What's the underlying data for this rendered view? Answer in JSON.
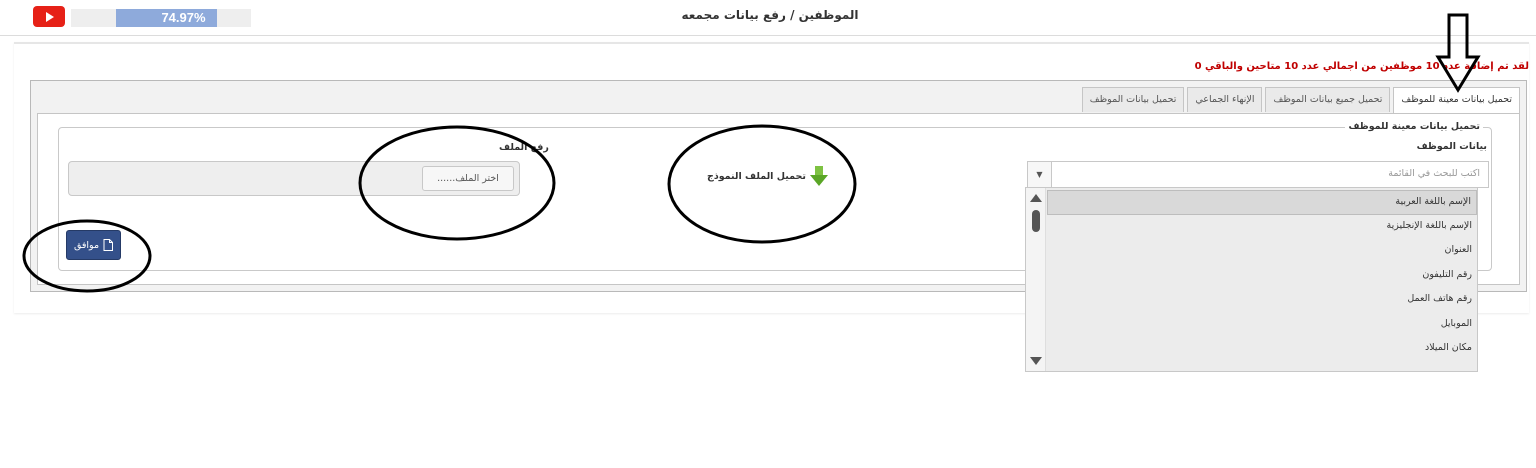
{
  "topbar": {
    "progress_text": "74.97%",
    "progress": 74.97,
    "page_title": "الموظفين / رفع بيانات مجمعه"
  },
  "notice": "لقد تم إضافة عدد 10 موظفين من اجمالي عدد 10 متاحين والباقي 0",
  "tabs": [
    {
      "label": "تحميل بيانات معينة للموظف",
      "active": true
    },
    {
      "label": "تحميل جميع بيانات الموظف",
      "active": false
    },
    {
      "label": "الإنهاء الجماعي",
      "active": false
    },
    {
      "label": "تحميل بيانات الموظف",
      "active": false
    }
  ],
  "panel": {
    "legend": "تحميل بيانات معينة للموظف",
    "employee_data_label": "بيانات الموظف",
    "select_placeholder": "اكتب للبحث في القائمة",
    "file_label": "رفع الملف",
    "file_button": "اختر الملف......",
    "download_template": "تحميل الملف النموذج",
    "ok_button": "موافق"
  },
  "dropdown_items": [
    "الإسم باللغة العربية",
    "الإسم باللغة الإنجليزية",
    "العنوان",
    "رقم التليفون",
    "رقم هاتف العمل",
    "الموبايل",
    "مكان الميلاد"
  ],
  "colors": {
    "youtube_red": "#e62117",
    "progress_fill": "#8eaadb",
    "notice_red": "#c00000",
    "ok_button": "#34508a"
  },
  "icons": {
    "youtube": "play-icon",
    "download": "green-down-arrow-icon",
    "ok": "file-icon",
    "annotation": "down-arrow-outline-icon"
  }
}
